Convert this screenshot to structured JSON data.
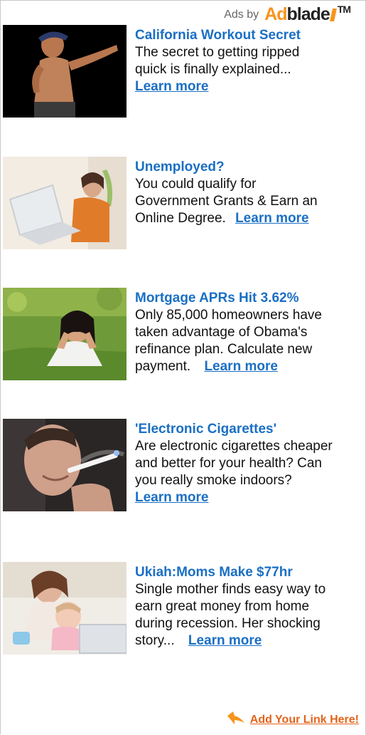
{
  "header": {
    "ads_by": "Ads by",
    "logo_ad": "Ad",
    "logo_blade": "blade",
    "logo_tm": "TM"
  },
  "ads": [
    {
      "title": "California Workout Secret",
      "lines": [
        "The secret to getting ripped",
        "quick is finally explained..."
      ],
      "learn": "Learn more",
      "image": "shirtless-man-icon"
    },
    {
      "title": "Unemployed?",
      "lines": [
        "You could qualify for",
        "Government Grants & Earn an",
        "Online Degree."
      ],
      "learn": "Learn more",
      "image": "woman-laptop-icon"
    },
    {
      "title": "Mortgage APRs Hit 3.62%",
      "lines": [
        "Only 85,000 homeowners have",
        "taken advantage of Obama's",
        "refinance plan. Calculate new",
        "payment."
      ],
      "learn": "Learn more",
      "image": "woman-grass-icon"
    },
    {
      "title": "'Electronic Cigarettes'",
      "lines": [
        "Are electronic cigarettes cheaper",
        "and better for your health? Can",
        "you really smoke indoors?"
      ],
      "learn": "Learn more",
      "image": "man-smoking-icon"
    },
    {
      "title": "Ukiah:Moms Make $77hr",
      "lines": [
        "Single mother finds easy way to",
        "earn great money from home",
        "during recession. Her shocking",
        "story..."
      ],
      "learn": "Learn more",
      "image": "mother-baby-icon"
    }
  ],
  "footer": {
    "add_link": "Add Your Link Here!"
  },
  "colors": {
    "link": "#1a6fc4",
    "brand_orange": "#f7941d",
    "footer_link": "#e2631b"
  }
}
